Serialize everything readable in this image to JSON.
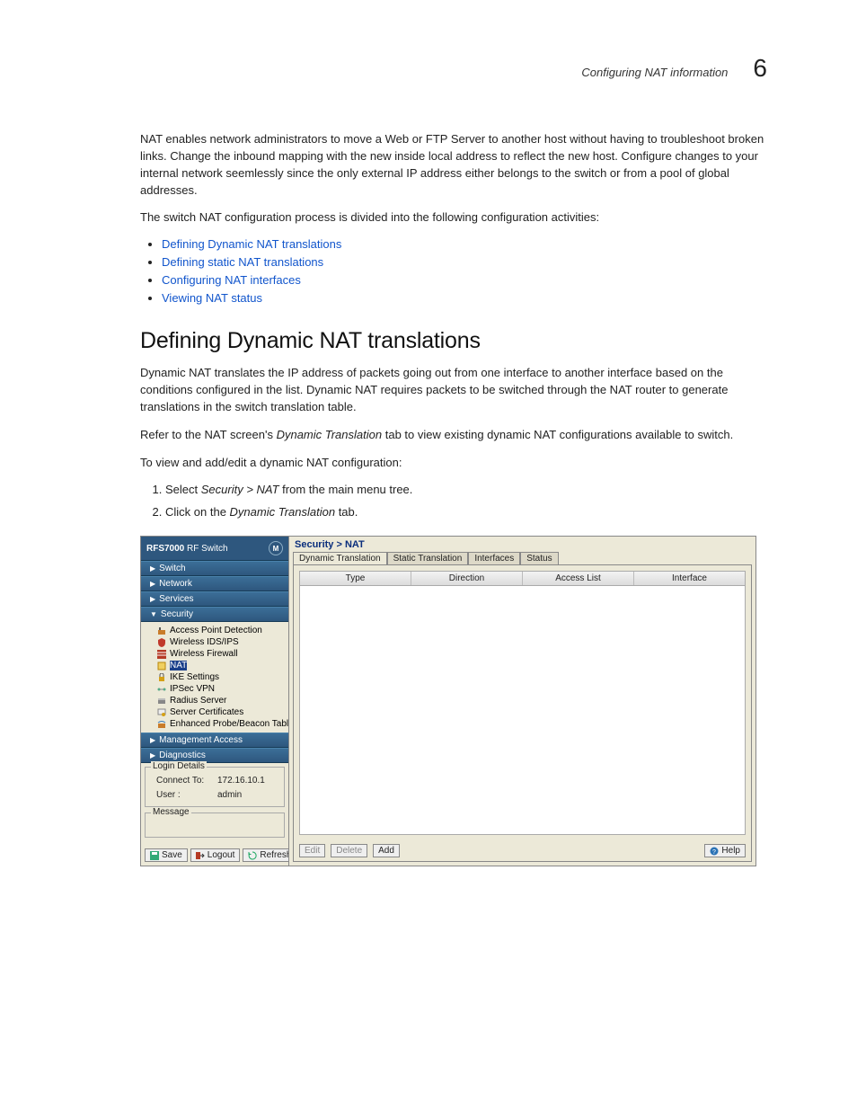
{
  "header": {
    "title": "Configuring NAT information",
    "chapter_number": "6"
  },
  "intro_paragraph": "NAT enables network administrators to move a Web or FTP Server to another host without having to troubleshoot broken links. Change the inbound mapping with the new inside local address to reflect the new host. Configure changes to your internal network seemlessly since the only external IP address either belongs to the switch or from a pool of global addresses.",
  "intro_lead": "The switch NAT configuration process is divided into the following configuration activities:",
  "links": [
    "Defining Dynamic NAT translations",
    "Defining static NAT translations",
    "Configuring NAT interfaces",
    "Viewing NAT status"
  ],
  "section_heading": "Defining Dynamic NAT translations",
  "section_p1": "Dynamic NAT translates the IP address of packets going out from one interface to another interface based on the conditions configured in the list. Dynamic NAT requires packets to be switched through the NAT router to generate translations in the switch translation table.",
  "section_p2_pre": "Refer to the NAT screen's ",
  "section_p2_em": "Dynamic Translation",
  "section_p2_post": " tab to view existing dynamic NAT configurations available to switch.",
  "section_p3": "To view and add/edit a dynamic NAT configuration:",
  "steps": {
    "s1_pre": "Select ",
    "s1_em": "Security > NAT",
    "s1_post": " from the main menu tree.",
    "s2_pre": "Click on the ",
    "s2_em": "Dynamic Translation",
    "s2_post": " tab."
  },
  "app": {
    "device_label_bold": "RFS7000",
    "device_label_rest": " RF Switch",
    "nav": {
      "items": [
        {
          "label": "Switch",
          "expanded": false
        },
        {
          "label": "Network",
          "expanded": false
        },
        {
          "label": "Services",
          "expanded": false
        },
        {
          "label": "Security",
          "expanded": true,
          "children": [
            {
              "label": "Access Point Detection",
              "icon": "ap"
            },
            {
              "label": "Wireless IDS/IPS",
              "icon": "ids"
            },
            {
              "label": "Wireless Firewall",
              "icon": "fw"
            },
            {
              "label": "NAT",
              "icon": "nat",
              "selected": true
            },
            {
              "label": "IKE Settings",
              "icon": "lock"
            },
            {
              "label": "IPSec VPN",
              "icon": "vpn"
            },
            {
              "label": "Radius Server",
              "icon": "radius"
            },
            {
              "label": "Server Certificates",
              "icon": "cert"
            },
            {
              "label": "Enhanced Probe/Beacon Table",
              "icon": "probe"
            }
          ]
        },
        {
          "label": "Management Access",
          "expanded": false
        },
        {
          "label": "Diagnostics",
          "expanded": false
        }
      ]
    },
    "login": {
      "legend": "Login Details",
      "rows": [
        {
          "k": "Connect To:",
          "v": "172.16.10.1"
        },
        {
          "k": "User :",
          "v": "admin"
        }
      ]
    },
    "message_legend": "Message",
    "side_buttons": {
      "save": "Save",
      "logout": "Logout",
      "refresh": "Refresh"
    },
    "breadcrumb": "Security > NAT",
    "tabs": [
      "Dynamic Translation",
      "Static Translation",
      "Interfaces",
      "Status"
    ],
    "active_tab_index": 0,
    "columns": [
      "Type",
      "Direction",
      "Access List",
      "Interface"
    ],
    "panel_buttons": {
      "edit": "Edit",
      "delete": "Delete",
      "add": "Add",
      "help": "Help"
    }
  }
}
